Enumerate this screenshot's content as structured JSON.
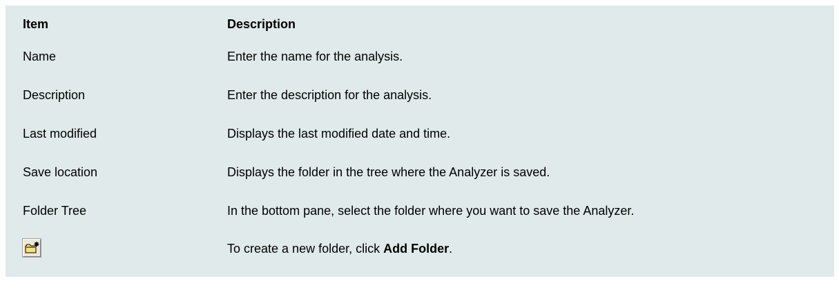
{
  "table": {
    "header": {
      "item": "Item",
      "description": "Description"
    },
    "rows": [
      {
        "item": "Name",
        "description": "Enter the name for the analysis."
      },
      {
        "item": "Description",
        "description": "Enter the description for the analysis."
      },
      {
        "item": "Last modified",
        "description": "Displays the last modified date and time."
      },
      {
        "item": "Save location",
        "description": "Displays the folder in the tree where the Analyzer is saved."
      },
      {
        "item": "Folder Tree",
        "description": "In the bottom pane, select the folder where you want to save the Analyzer."
      }
    ],
    "icon_row": {
      "icon": "add-folder-icon",
      "description_prefix": "To create a new folder, click ",
      "description_bold": "Add Folder",
      "description_suffix": "."
    }
  },
  "colors": {
    "table_background": "#e0eaea",
    "folder_fill": "#f5e07a",
    "folder_outline": "#000000"
  }
}
